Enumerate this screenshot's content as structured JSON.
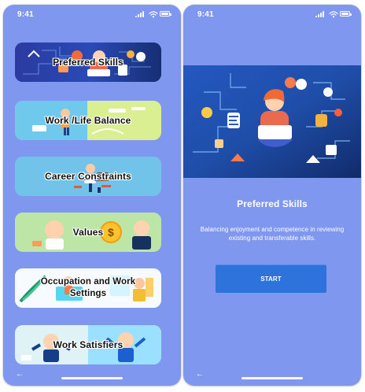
{
  "left_screen": {
    "status_time": "9:41",
    "cards": [
      {
        "label": "Preferred Skills"
      },
      {
        "label": "Work /Life Balance"
      },
      {
        "label": "Career Constraints"
      },
      {
        "label": "Values"
      },
      {
        "label": "Occupation and Work Settings"
      },
      {
        "label": "Work Satisfiers"
      }
    ],
    "back_icon": "arrow-left-icon"
  },
  "right_screen": {
    "status_time": "9:41",
    "title": "Preferred Skills",
    "description": "Balancing enjoyment and competence in reviewing existing and transferable skills.",
    "start_label": "START",
    "back_icon": "arrow-left-icon"
  },
  "icons": {
    "signal": "signal-icon",
    "wifi": "wifi-icon",
    "battery": "battery-icon"
  },
  "colors": {
    "screen_background": "#7f97ef",
    "start_button": "#2d73db",
    "hero_dark_blue": "#1d3f97"
  }
}
